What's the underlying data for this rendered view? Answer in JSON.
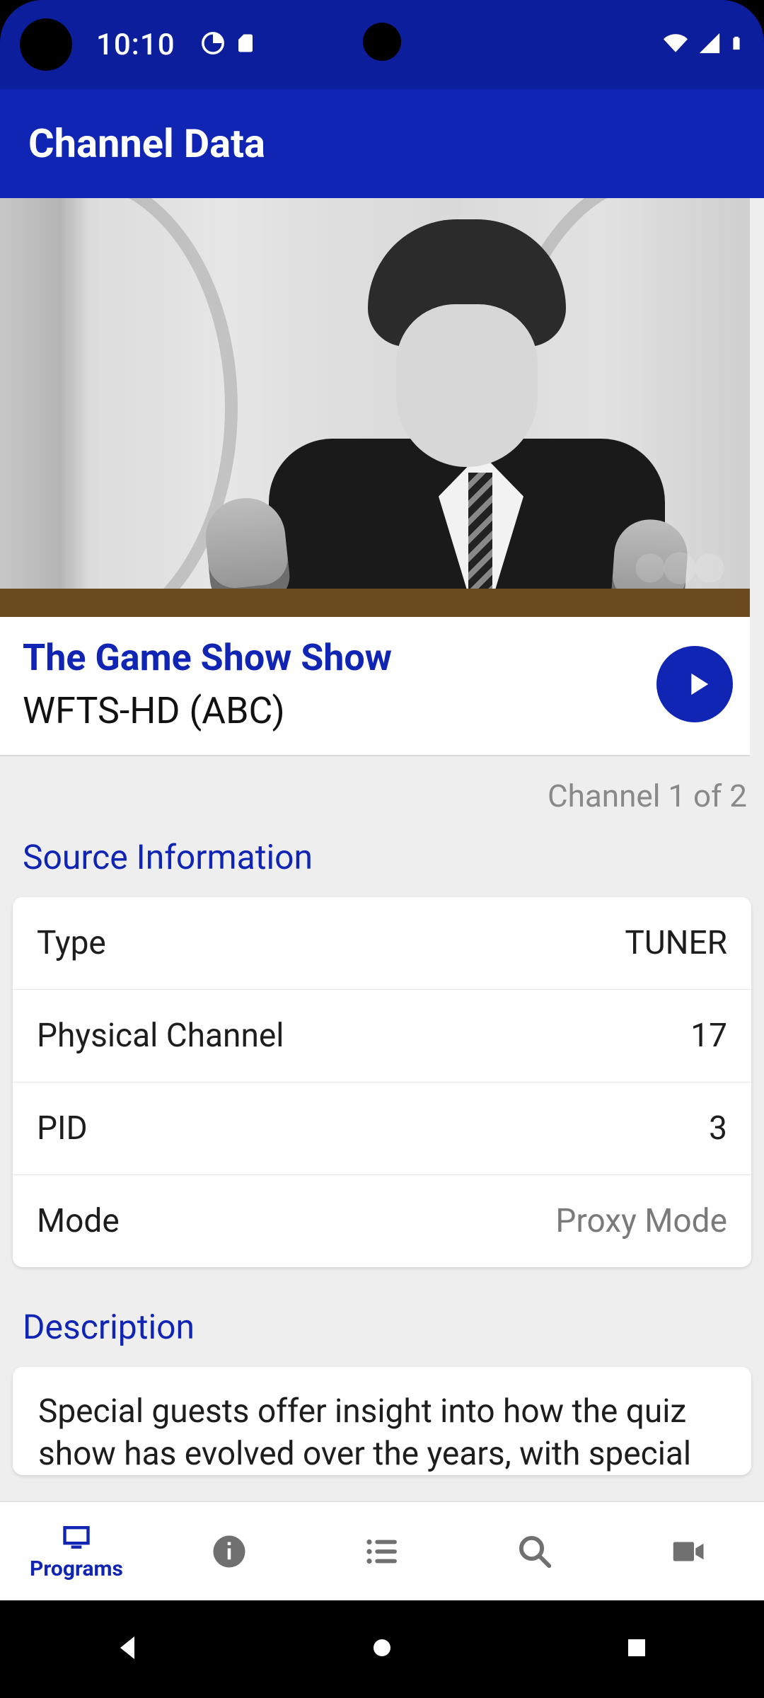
{
  "status": {
    "clock": "10:10"
  },
  "appbar": {
    "title": "Channel Data"
  },
  "program": {
    "title": "The Game Show Show",
    "channel": "WFTS-HD (ABC)"
  },
  "channel_counter": "Channel 1 of 2",
  "sections": {
    "source_info": {
      "heading": "Source Information",
      "rows": [
        {
          "k": "Type",
          "v": "TUNER",
          "muted": false
        },
        {
          "k": "Physical Channel",
          "v": "17",
          "muted": false
        },
        {
          "k": "PID",
          "v": "3",
          "muted": false
        },
        {
          "k": "Mode",
          "v": "Proxy Mode",
          "muted": true
        }
      ]
    },
    "description": {
      "heading": "Description",
      "text": "Special guests offer insight into how the quiz show has evolved over the years, with special"
    }
  },
  "bottomnav": {
    "items": [
      {
        "id": "programs",
        "label": "Programs",
        "active": true
      },
      {
        "id": "info",
        "label": "",
        "active": false
      },
      {
        "id": "list",
        "label": "",
        "active": false
      },
      {
        "id": "search",
        "label": "",
        "active": false
      },
      {
        "id": "video",
        "label": "",
        "active": false
      }
    ]
  }
}
